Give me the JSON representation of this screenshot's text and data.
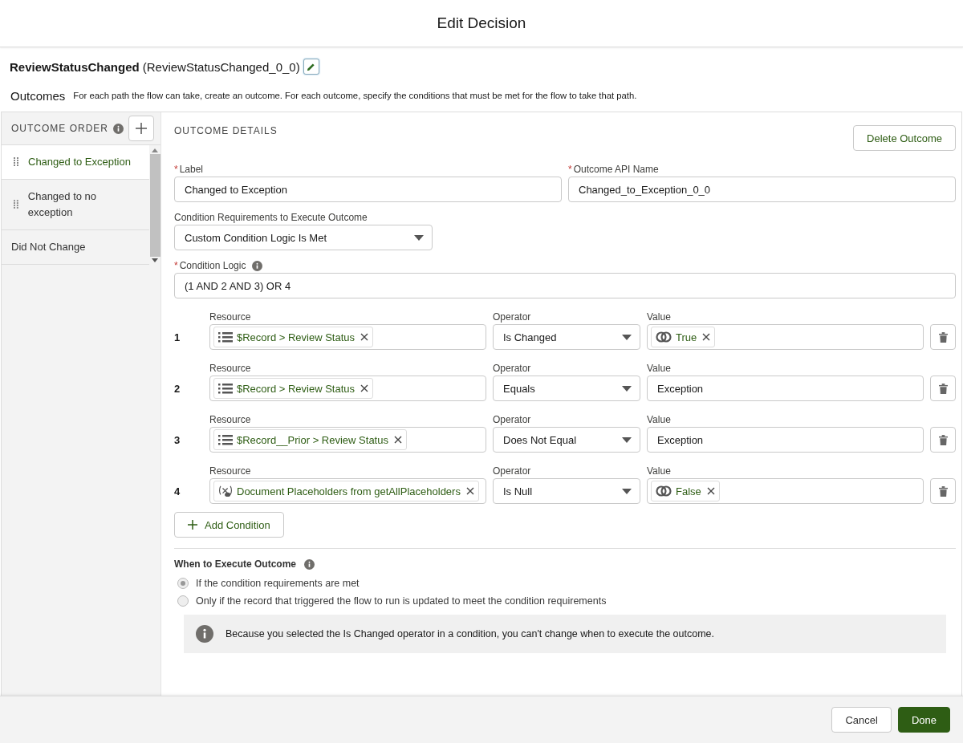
{
  "dialog": {
    "title": "Edit Decision"
  },
  "element": {
    "label": "ReviewStatusChanged",
    "api_name": "(ReviewStatusChanged_0_0)"
  },
  "outcomes_header": {
    "title": "Outcomes",
    "description": "For each path the flow can take, create an outcome. For each outcome, specify the conditions that must be met for the flow to take that path."
  },
  "sidebar": {
    "heading": "OUTCOME ORDER",
    "items": [
      {
        "label": "Changed to Exception",
        "selected": true,
        "draggable": true
      },
      {
        "label": "Changed to no exception",
        "selected": false,
        "draggable": true
      },
      {
        "label": "Did Not Change",
        "selected": false,
        "draggable": false
      }
    ]
  },
  "details": {
    "heading": "OUTCOME DETAILS",
    "delete_button": "Delete Outcome",
    "label_field": {
      "required_marker": "*",
      "label": "Label",
      "value": "Changed to Exception"
    },
    "api_field": {
      "required_marker": "*",
      "label": "Outcome API Name",
      "value": "Changed_to_Exception_0_0"
    },
    "requirements": {
      "label": "Condition Requirements to Execute Outcome",
      "value": "Custom Condition Logic Is Met"
    },
    "logic_field": {
      "required_marker": "*",
      "label": "Condition Logic",
      "value": "(1 AND 2 AND 3) OR 4"
    },
    "conditions": [
      {
        "number": "1",
        "resource_label": "Resource",
        "resource": {
          "kind": "list",
          "text": "$Record > Review Status"
        },
        "operator_label": "Operator",
        "operator": "Is Changed",
        "value_label": "Value",
        "value": {
          "kind": "pill",
          "text": "True"
        }
      },
      {
        "number": "2",
        "resource_label": "Resource",
        "resource": {
          "kind": "list",
          "text": "$Record > Review Status"
        },
        "operator_label": "Operator",
        "operator": "Equals",
        "value_label": "Value",
        "value": {
          "kind": "text",
          "text": "Exception"
        }
      },
      {
        "number": "3",
        "resource_label": "Resource",
        "resource": {
          "kind": "list",
          "text": "$Record__Prior > Review Status"
        },
        "operator_label": "Operator",
        "operator": "Does Not Equal",
        "value_label": "Value",
        "value": {
          "kind": "text",
          "text": "Exception"
        }
      },
      {
        "number": "4",
        "resource_label": "Resource",
        "resource": {
          "kind": "variable",
          "text": "Document Placeholders from getAllPlaceholders"
        },
        "operator_label": "Operator",
        "operator": "Is Null",
        "value_label": "Value",
        "value": {
          "kind": "pill",
          "text": "False"
        }
      }
    ],
    "add_condition": "Add Condition",
    "execution": {
      "title": "When to Execute Outcome",
      "options": [
        {
          "label": "If the condition requirements are met",
          "selected": true,
          "disabled": true
        },
        {
          "label": "Only if the record that triggered the flow to run is updated to meet the condition requirements",
          "selected": false,
          "disabled": true
        }
      ],
      "notice": "Because you selected the Is Changed operator in a condition, you can't change when to execute the outcome."
    }
  },
  "footer": {
    "buttons": [
      {
        "label": "Cancel",
        "kind": "neutral"
      },
      {
        "label": "Done",
        "kind": "brand"
      }
    ]
  }
}
